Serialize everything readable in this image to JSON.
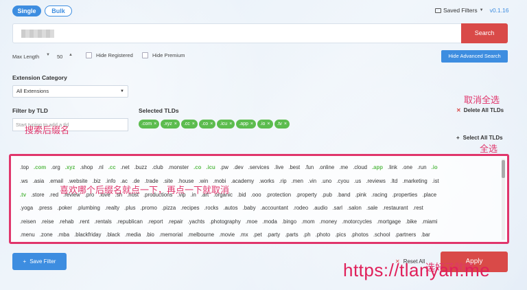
{
  "mode_tabs": {
    "single": "Single",
    "bulk": "Bulk"
  },
  "header": {
    "saved_filters": "Saved Filters",
    "version": "v0.1.16"
  },
  "search": {
    "value": "",
    "button": "Search"
  },
  "options": {
    "max_length_label": "Max Length",
    "max_length_value": "50",
    "hide_registered": "Hide Registered",
    "hide_premium": "Hide Premium",
    "advanced_button": "Hide Advanced Search"
  },
  "extension_category": {
    "label": "Extension Category",
    "selected": "All Extensions"
  },
  "filter_by_tld": {
    "label": "Filter by TLD",
    "placeholder": "Start typing to add a tld"
  },
  "selected_tlds": {
    "label": "Selected TLDs",
    "chips": [
      ".com",
      ".xyz",
      ".cc",
      ".co",
      ".icu",
      ".app",
      ".io",
      ".tv"
    ],
    "delete_all": "Delete All TLDs",
    "select_all": "Select All TLDs"
  },
  "annotations": {
    "search_suffix": "搜索后缀名",
    "cancel_all": "取消全选",
    "select_all": "全选",
    "click_tip": "喜欢哪个后缀名就点一下，再点一下就取消",
    "apply_label": "选好了就搜"
  },
  "tld_rows": [
    [
      ".top",
      ".com",
      ".org",
      ".xyz",
      ".shop",
      ".nl",
      ".cc",
      ".net",
      ".buzz",
      ".club",
      ".monster",
      ".co",
      ".icu",
      ".pw",
      ".dev",
      ".services",
      ".live",
      ".best",
      ".fun",
      ".online",
      ".me",
      ".cloud",
      ".app",
      ".link",
      ".one",
      ".run",
      ".io"
    ],
    [
      ".ws",
      ".asia",
      ".email",
      ".website",
      ".biz",
      ".info",
      ".ac",
      ".de",
      ".trade",
      ".site",
      ".house",
      ".win",
      ".mobi",
      ".academy",
      ".works",
      ".rip",
      ".men",
      ".vin",
      ".uno",
      ".cyou",
      ".us",
      ".reviews",
      ".ltd",
      ".marketing",
      ".ist"
    ],
    [
      ".tv",
      ".store",
      ".red",
      ".review",
      ".pro",
      ".love",
      ".sh",
      ".host",
      ".productions",
      ".vip",
      ".in",
      ".art",
      ".organic",
      ".bid",
      ".ooo",
      ".protection",
      ".property",
      ".pub",
      ".band",
      ".pink",
      ".racing",
      ".properties",
      ".place"
    ],
    [
      ".yoga",
      ".press",
      ".poker",
      ".plumbing",
      ".realty",
      ".plus",
      ".promo",
      ".pizza",
      ".recipes",
      ".rocks",
      ".autos",
      ".baby",
      ".accountant",
      ".rodeo",
      ".audio",
      ".sarl",
      ".salon",
      ".sale",
      ".restaurant",
      ".rest"
    ],
    [
      ".reisen",
      ".reise",
      ".rehab",
      ".rent",
      ".rentals",
      ".republican",
      ".report",
      ".repair",
      ".yachts",
      ".photography",
      ".moe",
      ".moda",
      ".bingo",
      ".mom",
      ".money",
      ".motorcycles",
      ".mortgage",
      ".bike",
      ".miami"
    ],
    [
      ".menu",
      ".zone",
      ".mba",
      ".blackfriday",
      ".black",
      ".media",
      ".bio",
      ".memorial",
      ".melbourne",
      ".movie",
      ".mx",
      ".pet",
      ".party",
      ".parts",
      ".ph",
      ".photo",
      ".pics",
      ".photos",
      ".school",
      ".partners",
      ".bar"
    ]
  ],
  "selected_tld_set": [
    ".com",
    ".xyz",
    ".cc",
    ".co",
    ".icu",
    ".app",
    ".io",
    ".tv"
  ],
  "footer": {
    "save_filter": "Save Filter",
    "reset_all": "Reset All",
    "apply": "Apply"
  },
  "watermark": "https://tlanyan.me",
  "colors": {
    "primary": "#3d8de0",
    "danger": "#d94a48",
    "selected_green": "#5cbc4e",
    "annotation": "#e0356b"
  }
}
